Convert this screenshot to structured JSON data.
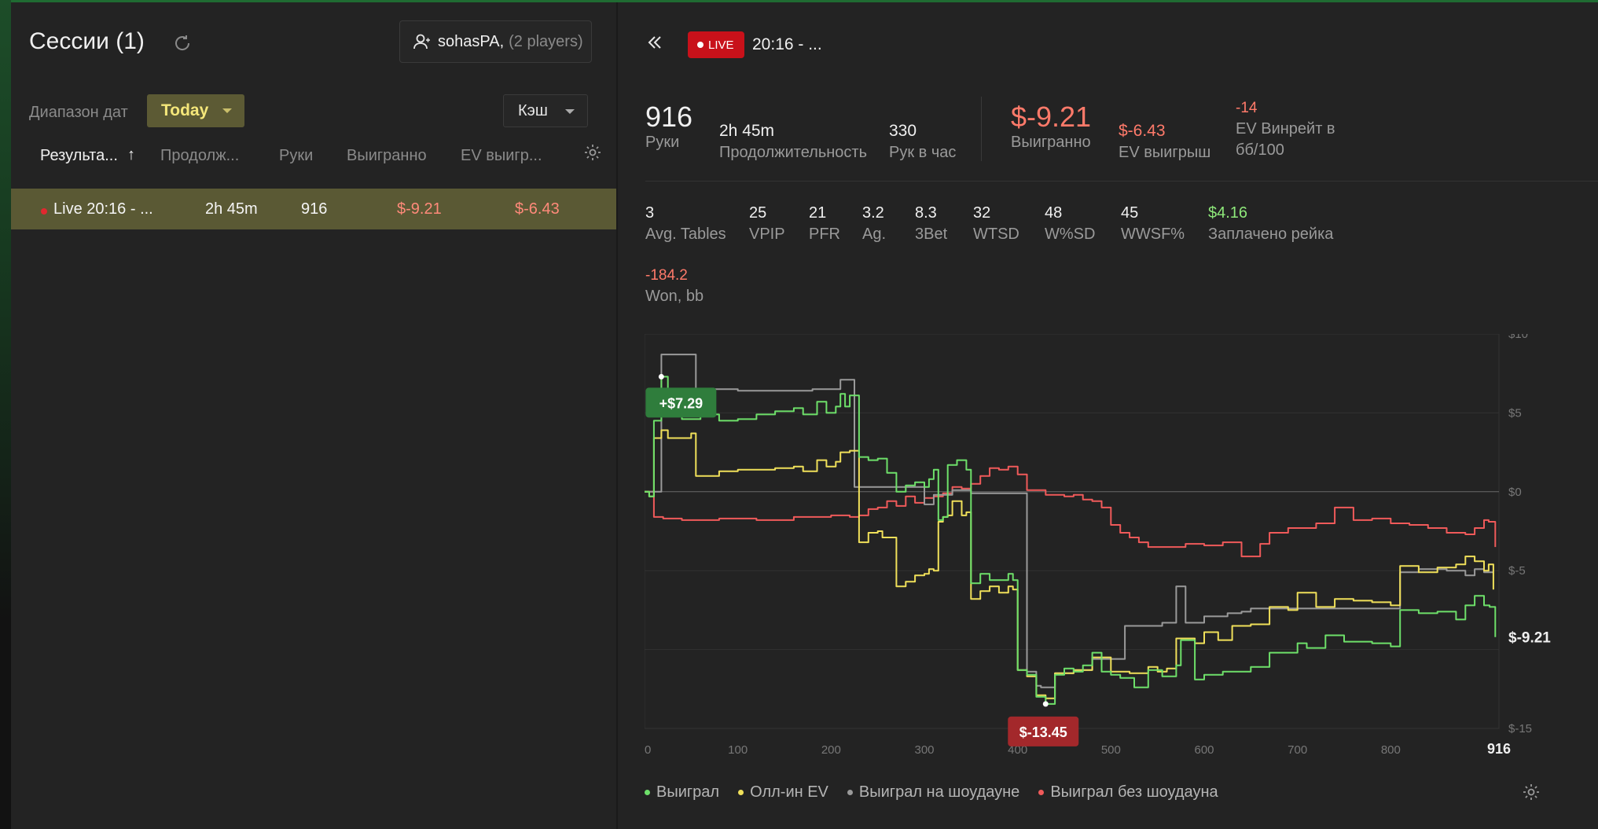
{
  "sessions": {
    "title": "Сессии (1)",
    "player_name": "sohasPA,",
    "player_count": "(2 players)",
    "date_range_label": "Диапазон дат",
    "date_range_value": "Today",
    "game_type": "Кэш",
    "columns": [
      "Результа...",
      "Продолж...",
      "Руки",
      "Выигранно",
      "EV выигр..."
    ],
    "rows": [
      {
        "name": "Live 20:16 - ...",
        "duration": "2h 45m",
        "hands": "916",
        "won": "$-9.21",
        "ev_won": "$-6.43"
      }
    ]
  },
  "session_header": {
    "live_label": "LIVE",
    "name": "20:16 - ..."
  },
  "stats_top": {
    "hands": {
      "value": "916",
      "label": "Руки"
    },
    "duration": {
      "value": "2h 45m",
      "label": "Продолжительность"
    },
    "hands_per_hour": {
      "value": "330",
      "label": "Рук в час"
    },
    "won": {
      "value": "$-9.21",
      "label": "Выигранно"
    },
    "ev_won": {
      "value": "$-6.43",
      "label": "EV выигрыш"
    },
    "ev_winrate": {
      "value": "-14",
      "label_1": "EV Винрейт в",
      "label_2": "бб/100"
    }
  },
  "stats_mid": [
    {
      "value": "3",
      "label": "Avg. Tables",
      "tone": ""
    },
    {
      "value": "25",
      "label": "VPIP",
      "tone": ""
    },
    {
      "value": "21",
      "label": "PFR",
      "tone": ""
    },
    {
      "value": "3.2",
      "label": "Ag.",
      "tone": ""
    },
    {
      "value": "8.3",
      "label": "3Bet",
      "tone": ""
    },
    {
      "value": "32",
      "label": "WTSD",
      "tone": ""
    },
    {
      "value": "48",
      "label": "W%SD",
      "tone": ""
    },
    {
      "value": "45",
      "label": "WWSF%",
      "tone": ""
    },
    {
      "value": "$4.16",
      "label": "Заплачено рейка",
      "tone": "pos"
    }
  ],
  "stats_bottom": {
    "value": "-184.2",
    "label": "Won, bb"
  },
  "colors": {
    "won": "#6ee06a",
    "allin_ev": "#f0e05a",
    "showdown": "#9a9a9a",
    "no_showdown": "#f05a5a",
    "accent": "#5a5934"
  },
  "legend": [
    {
      "label": "Выиграл",
      "color": "#6ee06a"
    },
    {
      "label": "Олл-ин EV",
      "color": "#f0e05a"
    },
    {
      "label": "Выиграл на шоудауне",
      "color": "#9a9a9a"
    },
    {
      "label": "Выиграл без шоудауна",
      "color": "#f05a5a"
    }
  ],
  "chart_data": {
    "type": "line",
    "xlim": [
      0,
      916
    ],
    "ylim": [
      -15,
      10
    ],
    "x_ticks": [
      0,
      100,
      200,
      300,
      400,
      500,
      600,
      700,
      800,
      916
    ],
    "y_ticks": [
      10,
      5,
      0,
      -5,
      -15
    ],
    "y_tick_labels": [
      "$10",
      "$5",
      "$0",
      "$-5",
      "$-15"
    ],
    "grid": true,
    "annotations": [
      {
        "label": "+$7.29",
        "x": 18,
        "y": 7.29
      },
      {
        "label": "$-13.45",
        "x": 430,
        "y": -13.45
      }
    ],
    "end_label": "$-9.21",
    "series": [
      {
        "key": "won",
        "points": [
          [
            0,
            0
          ],
          [
            5,
            -0.3
          ],
          [
            10,
            4.5
          ],
          [
            18,
            7.29
          ],
          [
            25,
            5.1
          ],
          [
            40,
            4.6
          ],
          [
            60,
            4.9
          ],
          [
            80,
            4.5
          ],
          [
            100,
            4.6
          ],
          [
            120,
            4.9
          ],
          [
            140,
            5.1
          ],
          [
            160,
            5.3
          ],
          [
            170,
            4.9
          ],
          [
            185,
            5.7
          ],
          [
            195,
            5.0
          ],
          [
            205,
            5.4
          ],
          [
            210,
            6.2
          ],
          [
            215,
            5.4
          ],
          [
            220,
            6.1
          ],
          [
            230,
            2.2
          ],
          [
            240,
            2.0
          ],
          [
            250,
            2.1
          ],
          [
            260,
            1.2
          ],
          [
            270,
            0
          ],
          [
            280,
            0.4
          ],
          [
            290,
            0.6
          ],
          [
            300,
            0.3
          ],
          [
            305,
            0.8
          ],
          [
            310,
            1.4
          ],
          [
            315,
            -1.8
          ],
          [
            320,
            -1.6
          ],
          [
            325,
            1.7
          ],
          [
            335,
            2.0
          ],
          [
            345,
            1.4
          ],
          [
            350,
            -5.8
          ],
          [
            360,
            -5.2
          ],
          [
            370,
            -5.6
          ],
          [
            390,
            -5.2
          ],
          [
            395,
            -5.6
          ],
          [
            400,
            -11.3
          ],
          [
            410,
            -11.6
          ],
          [
            420,
            -13.0
          ],
          [
            430,
            -13.45
          ],
          [
            440,
            -11.6
          ],
          [
            450,
            -11.2
          ],
          [
            460,
            -11.4
          ],
          [
            470,
            -11.0
          ],
          [
            480,
            -10.2
          ],
          [
            490,
            -11.4
          ],
          [
            500,
            -11.6
          ],
          [
            510,
            -11.8
          ],
          [
            525,
            -12.4
          ],
          [
            540,
            -11.3
          ],
          [
            555,
            -11.7
          ],
          [
            570,
            -11.0
          ],
          [
            575,
            -9.4
          ],
          [
            590,
            -11.9
          ],
          [
            600,
            -11.6
          ],
          [
            620,
            -11.4
          ],
          [
            650,
            -11.1
          ],
          [
            670,
            -10.2
          ],
          [
            700,
            -9.6
          ],
          [
            710,
            -9.9
          ],
          [
            730,
            -9.1
          ],
          [
            750,
            -9.5
          ],
          [
            780,
            -9.6
          ],
          [
            800,
            -9.8
          ],
          [
            810,
            -7.5
          ],
          [
            830,
            -7.7
          ],
          [
            850,
            -7.6
          ],
          [
            870,
            -8.1
          ],
          [
            880,
            -7.2
          ],
          [
            890,
            -6.6
          ],
          [
            900,
            -7.2
          ],
          [
            906,
            -7.3
          ],
          [
            912,
            -9.21
          ]
        ]
      },
      {
        "key": "allin_ev",
        "points": [
          [
            0,
            0
          ],
          [
            5,
            -0.3
          ],
          [
            10,
            3.4
          ],
          [
            18,
            3.9
          ],
          [
            25,
            3.4
          ],
          [
            50,
            3.7
          ],
          [
            55,
            1.0
          ],
          [
            80,
            1.3
          ],
          [
            100,
            1.4
          ],
          [
            140,
            1.5
          ],
          [
            160,
            1.6
          ],
          [
            170,
            1.3
          ],
          [
            185,
            2.0
          ],
          [
            195,
            1.6
          ],
          [
            205,
            1.9
          ],
          [
            210,
            2.5
          ],
          [
            220,
            2.6
          ],
          [
            230,
            -3.2
          ],
          [
            240,
            -2.6
          ],
          [
            250,
            -2.5
          ],
          [
            255,
            -2.9
          ],
          [
            260,
            -2.9
          ],
          [
            270,
            -6.0
          ],
          [
            280,
            -5.7
          ],
          [
            290,
            -5.3
          ],
          [
            300,
            -5.2
          ],
          [
            305,
            -4.9
          ],
          [
            310,
            -5.0
          ],
          [
            315,
            -1.9
          ],
          [
            320,
            -1.6
          ],
          [
            325,
            -1.5
          ],
          [
            330,
            -0.6
          ],
          [
            340,
            -1.5
          ],
          [
            345,
            -1.3
          ],
          [
            350,
            -6.8
          ],
          [
            360,
            -6.3
          ],
          [
            370,
            -6.0
          ],
          [
            380,
            -6.4
          ],
          [
            390,
            -6.0
          ],
          [
            395,
            -6.2
          ],
          [
            400,
            -11.3
          ],
          [
            410,
            -11.7
          ],
          [
            420,
            -12.9
          ],
          [
            430,
            -13.1
          ],
          [
            440,
            -11.5
          ],
          [
            460,
            -11.3
          ],
          [
            480,
            -10.5
          ],
          [
            500,
            -11.4
          ],
          [
            520,
            -11.5
          ],
          [
            540,
            -11.1
          ],
          [
            550,
            -11.4
          ],
          [
            560,
            -11.2
          ],
          [
            570,
            -9.3
          ],
          [
            590,
            -9.6
          ],
          [
            600,
            -8.9
          ],
          [
            615,
            -9.4
          ],
          [
            630,
            -8.5
          ],
          [
            650,
            -8.4
          ],
          [
            670,
            -7.3
          ],
          [
            690,
            -7.5
          ],
          [
            700,
            -6.4
          ],
          [
            720,
            -7.3
          ],
          [
            740,
            -6.8
          ],
          [
            760,
            -6.9
          ],
          [
            780,
            -7.0
          ],
          [
            800,
            -7.2
          ],
          [
            810,
            -4.7
          ],
          [
            830,
            -5.1
          ],
          [
            850,
            -4.8
          ],
          [
            870,
            -4.6
          ],
          [
            880,
            -4.1
          ],
          [
            890,
            -4.4
          ],
          [
            900,
            -5.0
          ],
          [
            905,
            -4.6
          ],
          [
            910,
            -6.2
          ]
        ]
      },
      {
        "key": "showdown",
        "points": [
          [
            0,
            0
          ],
          [
            10,
            0
          ],
          [
            18,
            8.7
          ],
          [
            50,
            8.7
          ],
          [
            55,
            6.5
          ],
          [
            100,
            6.4
          ],
          [
            140,
            6.4
          ],
          [
            180,
            6.5
          ],
          [
            200,
            6.5
          ],
          [
            210,
            7.1
          ],
          [
            220,
            7.1
          ],
          [
            225,
            0.3
          ],
          [
            250,
            0.3
          ],
          [
            300,
            -0.8
          ],
          [
            310,
            -0.2
          ],
          [
            320,
            -0.2
          ],
          [
            330,
            0.1
          ],
          [
            350,
            -0.1
          ],
          [
            400,
            -0.1
          ],
          [
            410,
            -11.4
          ],
          [
            420,
            -12.3
          ],
          [
            425,
            -12.4
          ],
          [
            430,
            -12.4
          ],
          [
            440,
            -11.5
          ],
          [
            460,
            -11.3
          ],
          [
            480,
            -10.6
          ],
          [
            500,
            -10.6
          ],
          [
            515,
            -8.5
          ],
          [
            540,
            -8.5
          ],
          [
            555,
            -8.3
          ],
          [
            570,
            -6.0
          ],
          [
            580,
            -8.3
          ],
          [
            600,
            -7.9
          ],
          [
            625,
            -7.7
          ],
          [
            640,
            -7.6
          ],
          [
            650,
            -7.4
          ],
          [
            700,
            -7.4
          ],
          [
            750,
            -7.4
          ],
          [
            810,
            -5.1
          ],
          [
            830,
            -4.9
          ],
          [
            860,
            -5.0
          ],
          [
            880,
            -5.3
          ],
          [
            890,
            -4.9
          ],
          [
            900,
            -5.1
          ],
          [
            910,
            -5.1
          ]
        ]
      },
      {
        "key": "no_showdown",
        "points": [
          [
            0,
            0
          ],
          [
            10,
            -1.6
          ],
          [
            20,
            -1.7
          ],
          [
            40,
            -1.8
          ],
          [
            80,
            -1.7
          ],
          [
            120,
            -1.8
          ],
          [
            160,
            -1.6
          ],
          [
            200,
            -1.5
          ],
          [
            220,
            -1.6
          ],
          [
            230,
            -1.5
          ],
          [
            240,
            -1.1
          ],
          [
            250,
            -1.0
          ],
          [
            260,
            -0.6
          ],
          [
            270,
            -0.9
          ],
          [
            280,
            -0.3
          ],
          [
            290,
            -0.7
          ],
          [
            300,
            -0.4
          ],
          [
            310,
            -0.3
          ],
          [
            320,
            -0.1
          ],
          [
            330,
            0.3
          ],
          [
            340,
            0.2
          ],
          [
            350,
            0.5
          ],
          [
            360,
            1.0
          ],
          [
            370,
            1.5
          ],
          [
            380,
            1.4
          ],
          [
            390,
            1.6
          ],
          [
            400,
            1.1
          ],
          [
            410,
            0.1
          ],
          [
            430,
            -0.2
          ],
          [
            450,
            -0.3
          ],
          [
            460,
            -0.2
          ],
          [
            470,
            -0.5
          ],
          [
            480,
            -0.6
          ],
          [
            490,
            -1.0
          ],
          [
            500,
            -2.1
          ],
          [
            510,
            -2.6
          ],
          [
            520,
            -2.9
          ],
          [
            530,
            -3.2
          ],
          [
            540,
            -3.5
          ],
          [
            560,
            -3.5
          ],
          [
            580,
            -3.3
          ],
          [
            600,
            -3.4
          ],
          [
            620,
            -3.2
          ],
          [
            640,
            -4.1
          ],
          [
            660,
            -3.3
          ],
          [
            670,
            -2.6
          ],
          [
            690,
            -2.3
          ],
          [
            720,
            -2.0
          ],
          [
            740,
            -1.0
          ],
          [
            760,
            -1.8
          ],
          [
            780,
            -1.7
          ],
          [
            800,
            -2.0
          ],
          [
            820,
            -2.1
          ],
          [
            840,
            -2.3
          ],
          [
            860,
            -2.6
          ],
          [
            880,
            -2.7
          ],
          [
            890,
            -2.3
          ],
          [
            900,
            -1.8
          ],
          [
            905,
            -1.9
          ],
          [
            912,
            -3.5
          ]
        ]
      }
    ]
  }
}
